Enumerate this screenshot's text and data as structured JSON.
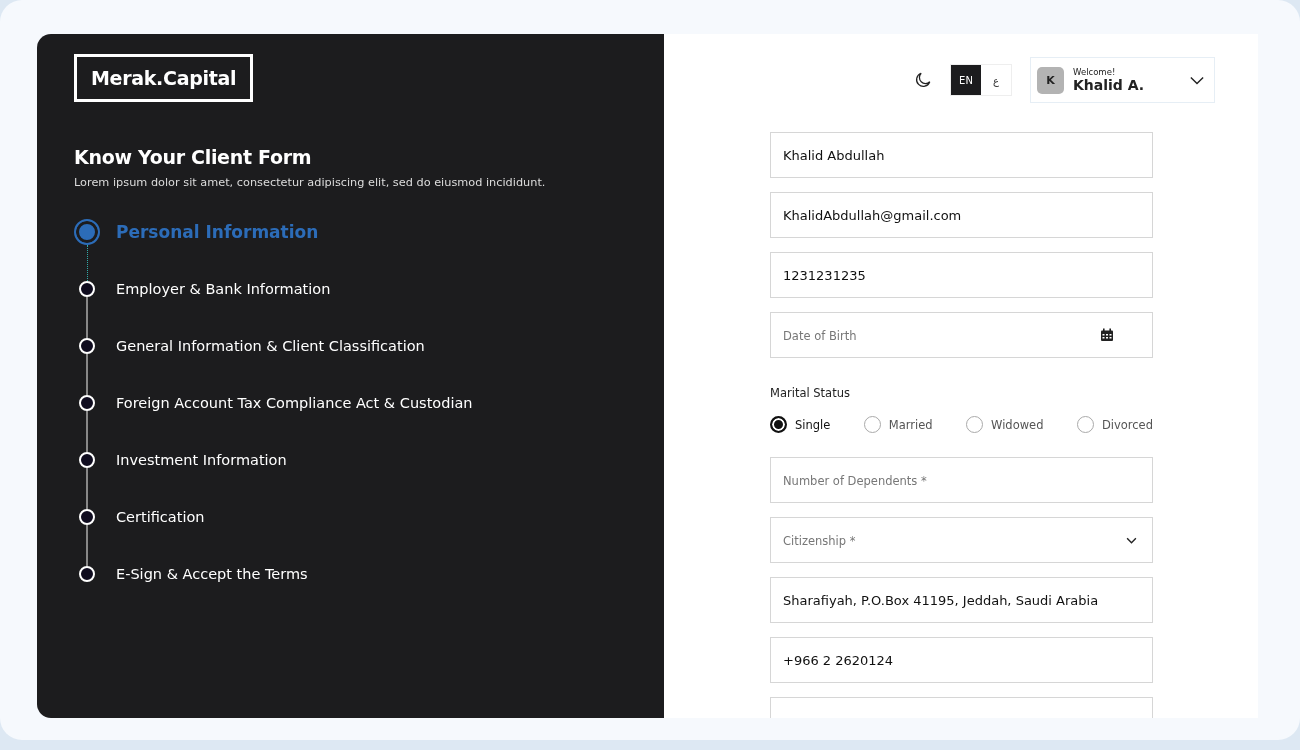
{
  "brand": {
    "logo": "Merak.Capital"
  },
  "intro": {
    "title": "Know Your Client Form",
    "subtitle": "Lorem ipsum dolor sit amet, consectetur adipiscing elit, sed do eiusmod incididunt."
  },
  "steps": [
    {
      "label": "Personal Information",
      "selected": true
    },
    {
      "label": "Employer & Bank Information",
      "selected": false
    },
    {
      "label": "General Information & Client Classification",
      "selected": false
    },
    {
      "label": "Foreign Account Tax Compliance Act & Custodian",
      "selected": false
    },
    {
      "label": "Investment Information",
      "selected": false
    },
    {
      "label": "Certification",
      "selected": false
    },
    {
      "label": "E-Sign & Accept the Terms",
      "selected": false
    }
  ],
  "header": {
    "languages": [
      {
        "label": "EN",
        "selected": true
      },
      {
        "label": "ع",
        "selected": false
      }
    ],
    "user": {
      "avatar": "K",
      "greeting": "Welcome!",
      "name": "Khalid A."
    }
  },
  "form": [
    {
      "kind": "input",
      "value": "Khalid Abdullah"
    },
    {
      "kind": "input",
      "value": "KhalidAbdullah@gmail.com"
    },
    {
      "kind": "input",
      "value": "1231231235"
    },
    {
      "kind": "date",
      "placeholder": "Date of Birth"
    },
    {
      "kind": "radio_group",
      "label": "Marital Status",
      "options": [
        {
          "label": "Single",
          "selected": true
        },
        {
          "label": "Married",
          "selected": false
        },
        {
          "label": "Widowed",
          "selected": false
        },
        {
          "label": "Divorced",
          "selected": false
        }
      ]
    },
    {
      "kind": "input",
      "placeholder": "Number of Dependents *"
    },
    {
      "kind": "select",
      "placeholder": "Citizenship *"
    },
    {
      "kind": "input",
      "value": "Sharafiyah, P.O.Box 41195, Jeddah, Saudi Arabia"
    },
    {
      "kind": "input",
      "value": "+966 2 2620124"
    },
    {
      "kind": "input"
    }
  ]
}
